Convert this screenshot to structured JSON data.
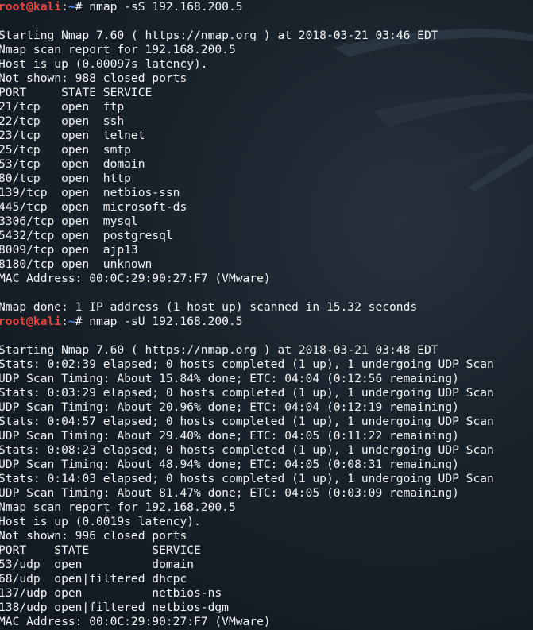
{
  "window": {
    "title": "root@kali: ~"
  },
  "colors": {
    "background": "#151b23",
    "text": "#f2f4f6",
    "prompt_user": "#e0443f",
    "prompt_path": "#4f8ff7"
  },
  "background_art": "kali-dragon-icon",
  "prompts": [
    {
      "user": "root@kali",
      "sep": ":",
      "cwd": "~",
      "symbol": "# ",
      "command": "nmap -sS 192.168.200.5"
    },
    {
      "user": "root@kali",
      "sep": ":",
      "cwd": "~",
      "symbol": "# ",
      "command": "nmap -sU 192.168.200.5"
    }
  ],
  "tcp_scan": {
    "start": "Starting Nmap 7.60 ( https://nmap.org ) at 2018-03-21 03:46 EDT",
    "report": "Nmap scan report for 192.168.200.5",
    "host_up": "Host is up (0.00097s latency).",
    "not_shown": "Not shown: 988 closed ports",
    "table_header": "PORT     STATE SERVICE",
    "ports": [
      "21/tcp   open  ftp",
      "22/tcp   open  ssh",
      "23/tcp   open  telnet",
      "25/tcp   open  smtp",
      "53/tcp   open  domain",
      "80/tcp   open  http",
      "139/tcp  open  netbios-ssn",
      "445/tcp  open  microsoft-ds",
      "3306/tcp open  mysql",
      "5432/tcp open  postgresql",
      "8009/tcp open  ajp13",
      "8180/tcp open  unknown"
    ],
    "mac": "MAC Address: 00:0C:29:90:27:F7 (VMware)",
    "done": "Nmap done: 1 IP address (1 host up) scanned in 15.32 seconds"
  },
  "udp_scan": {
    "start": "Starting Nmap 7.60 ( https://nmap.org ) at 2018-03-21 03:48 EDT",
    "progress": [
      "Stats: 0:02:39 elapsed; 0 hosts completed (1 up), 1 undergoing UDP Scan",
      "UDP Scan Timing: About 15.84% done; ETC: 04:04 (0:12:56 remaining)",
      "Stats: 0:03:29 elapsed; 0 hosts completed (1 up), 1 undergoing UDP Scan",
      "UDP Scan Timing: About 20.96% done; ETC: 04:04 (0:12:19 remaining)",
      "Stats: 0:04:57 elapsed; 0 hosts completed (1 up), 1 undergoing UDP Scan",
      "UDP Scan Timing: About 29.40% done; ETC: 04:05 (0:11:22 remaining)",
      "Stats: 0:08:23 elapsed; 0 hosts completed (1 up), 1 undergoing UDP Scan",
      "UDP Scan Timing: About 48.94% done; ETC: 04:05 (0:08:31 remaining)",
      "Stats: 0:14:03 elapsed; 0 hosts completed (1 up), 1 undergoing UDP Scan",
      "UDP Scan Timing: About 81.47% done; ETC: 04:05 (0:03:09 remaining)"
    ],
    "report": "Nmap scan report for 192.168.200.5",
    "host_up": "Host is up (0.0019s latency).",
    "not_shown": "Not shown: 996 closed ports",
    "table_header": "PORT    STATE         SERVICE",
    "ports": [
      "53/udp  open          domain",
      "68/udp  open|filtered dhcpc",
      "137/udp open          netbios-ns",
      "138/udp open|filtered netbios-dgm"
    ],
    "mac": "MAC Address: 00:0C:29:90:27:F7 (VMware)"
  }
}
